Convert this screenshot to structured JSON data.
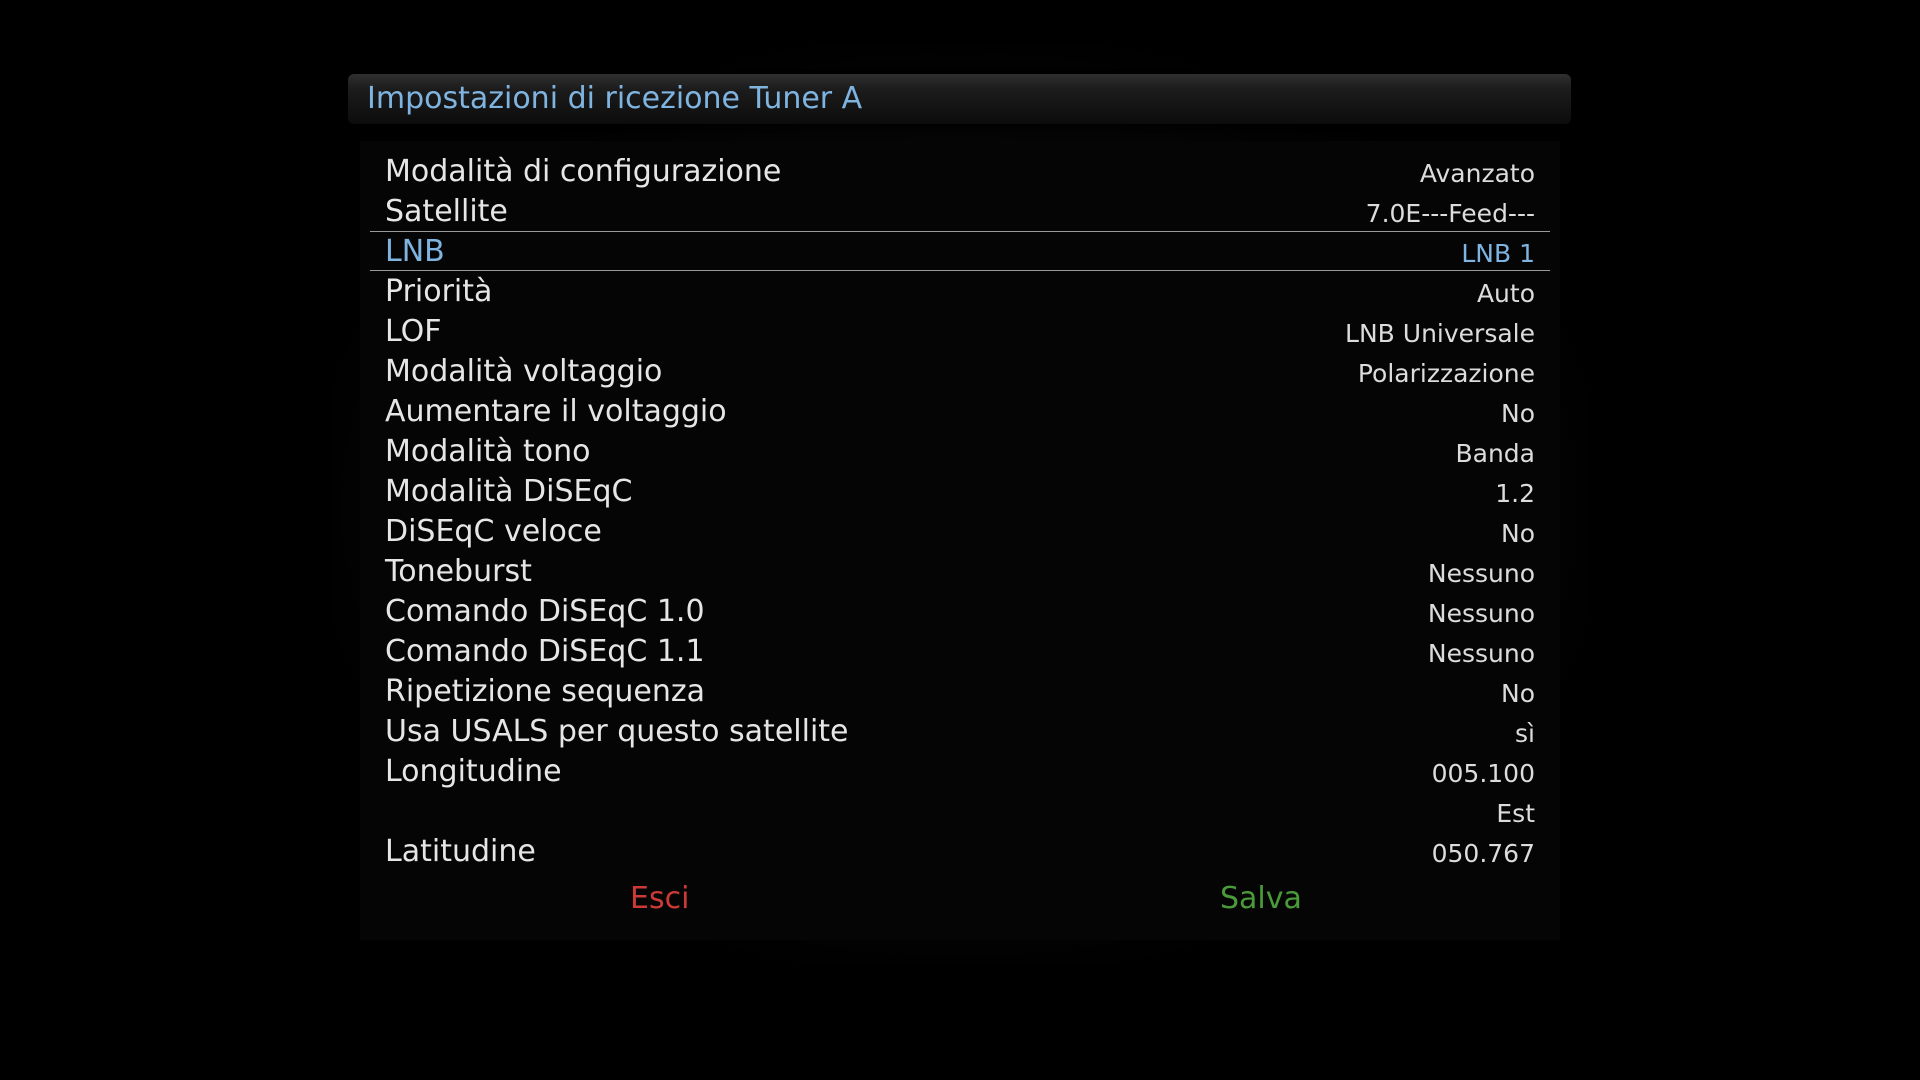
{
  "title": "Impostazioni di ricezione Tuner A",
  "colors": {
    "accent": "#7fb4e0",
    "exit": "#cc3a36",
    "save": "#4a9a3a"
  },
  "rows": [
    {
      "label": "Modalità di configurazione",
      "value": "Avanzato"
    },
    {
      "label": "Satellite",
      "value": "7.0E---Feed---"
    },
    {
      "label": "LNB",
      "value": "LNB 1",
      "selected": true
    },
    {
      "label": "Priorità",
      "value": "Auto"
    },
    {
      "label": "LOF",
      "value": "LNB Universale"
    },
    {
      "label": "Modalità voltaggio",
      "value": "Polarizzazione"
    },
    {
      "label": "Aumentare il voltaggio",
      "value": "No"
    },
    {
      "label": "Modalità tono",
      "value": "Banda"
    },
    {
      "label": "Modalità DiSEqC",
      "value": "1.2"
    },
    {
      "label": "DiSEqC veloce",
      "value": "No"
    },
    {
      "label": "Toneburst",
      "value": "Nessuno"
    },
    {
      "label": "Comando DiSEqC 1.0",
      "value": "Nessuno"
    },
    {
      "label": "Comando DiSEqC 1.1",
      "value": "Nessuno"
    },
    {
      "label": "Ripetizione sequenza",
      "value": "No"
    },
    {
      "label": "Usa USALS per questo satellite",
      "value": "sì"
    },
    {
      "label": "Longitudine",
      "value": "005.100"
    },
    {
      "label": "",
      "value": "Est"
    },
    {
      "label": "Latitudine",
      "value": "050.767"
    }
  ],
  "buttons": {
    "exit": "Esci",
    "save": "Salva"
  }
}
